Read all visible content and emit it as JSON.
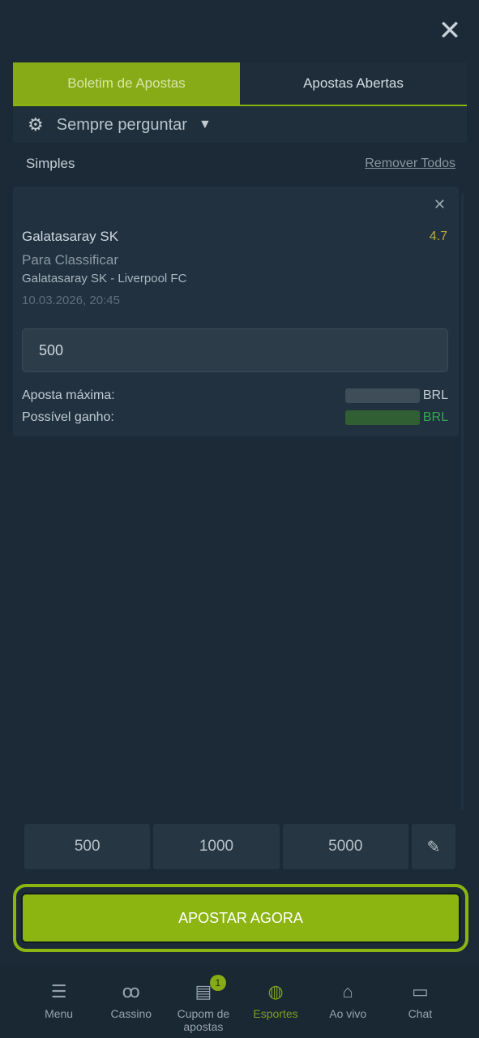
{
  "close_icon": "close-icon",
  "tabs": [
    {
      "label": "Boletim de Apostas",
      "active": true
    },
    {
      "label": "Apostas Abertas",
      "active": false
    }
  ],
  "preference": {
    "icon": "gear-icon",
    "label": "Sempre perguntar"
  },
  "section": {
    "title": "Simples",
    "remove_all": "Remover Todos"
  },
  "bet": {
    "team": "Galatasaray SK",
    "odds": "4.7",
    "market": "Para Classificar",
    "match": "Galatasaray SK - Liverpool FC",
    "datetime": "10.03.2026, 20:45",
    "stake": "500",
    "max_label": "Aposta máxima:",
    "max_currency": "BRL",
    "win_label": "Possível ganho:",
    "win_currency": "BRL"
  },
  "quick_amounts": [
    "500",
    "1000",
    "5000"
  ],
  "cta": "APOSTAR AGORA",
  "nav": [
    {
      "label": "Menu",
      "icon": "hamburger-icon"
    },
    {
      "label": "Cassino",
      "icon": "cherries-icon"
    },
    {
      "label": "Cupom de apostas",
      "icon": "receipt-icon",
      "badge": "1"
    },
    {
      "label": "Esportes",
      "icon": "basketball-icon",
      "active": true
    },
    {
      "label": "Ao vivo",
      "icon": "live-icon"
    },
    {
      "label": "Chat",
      "icon": "chat-icon"
    }
  ],
  "colors": {
    "accent": "#8db512",
    "background": "#1b2a36",
    "odds": "#bba93a"
  }
}
